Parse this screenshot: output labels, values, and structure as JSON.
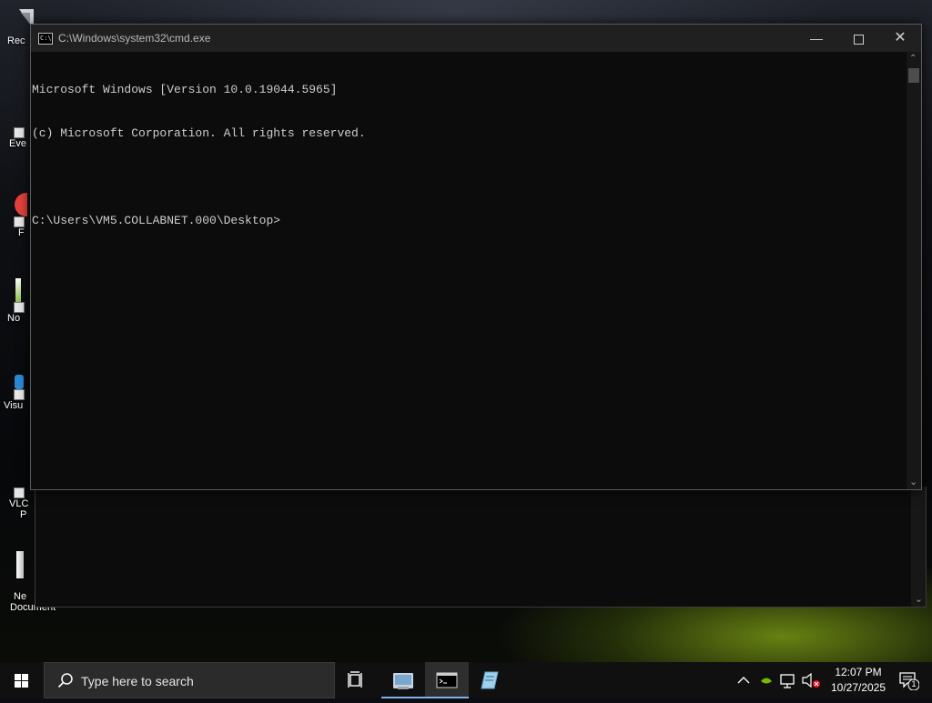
{
  "desktop": {
    "icons": [
      {
        "label": "Rec"
      },
      {
        "label": "Eve"
      },
      {
        "label": "F"
      },
      {
        "label": "No"
      },
      {
        "label": "Visu"
      },
      {
        "label": "VLC"
      },
      {
        "label": "P"
      },
      {
        "label": "Ne"
      },
      {
        "label": "Document"
      }
    ]
  },
  "cmd_window": {
    "title": "C:\\Windows\\system32\\cmd.exe",
    "icon": "cmd-icon",
    "lines": [
      "Microsoft Windows [Version 10.0.19044.5965]",
      "(c) Microsoft Corporation. All rights reserved.",
      "",
      "C:\\Users\\VM5.COLLABNET.000\\Desktop>"
    ],
    "controls": {
      "minimize": "minimize-icon",
      "maximize": "maximize-icon",
      "close": "close-icon"
    }
  },
  "taskbar": {
    "search_placeholder": "Type here to search",
    "apps": [
      {
        "name": "file-explorer-icon",
        "active": false
      },
      {
        "name": "command-prompt-icon",
        "active": true
      },
      {
        "name": "notepad-icon",
        "active": false
      }
    ],
    "clock": {
      "time": "12:07 PM",
      "date": "10/27/2025"
    },
    "notification_count": "1"
  },
  "colors": {
    "console_bg": "#0c0c0c",
    "console_text": "#cccccc",
    "titlebar_bg": "#202020",
    "taskbar_bg": "#101010",
    "accent": "#7fb1e8"
  }
}
